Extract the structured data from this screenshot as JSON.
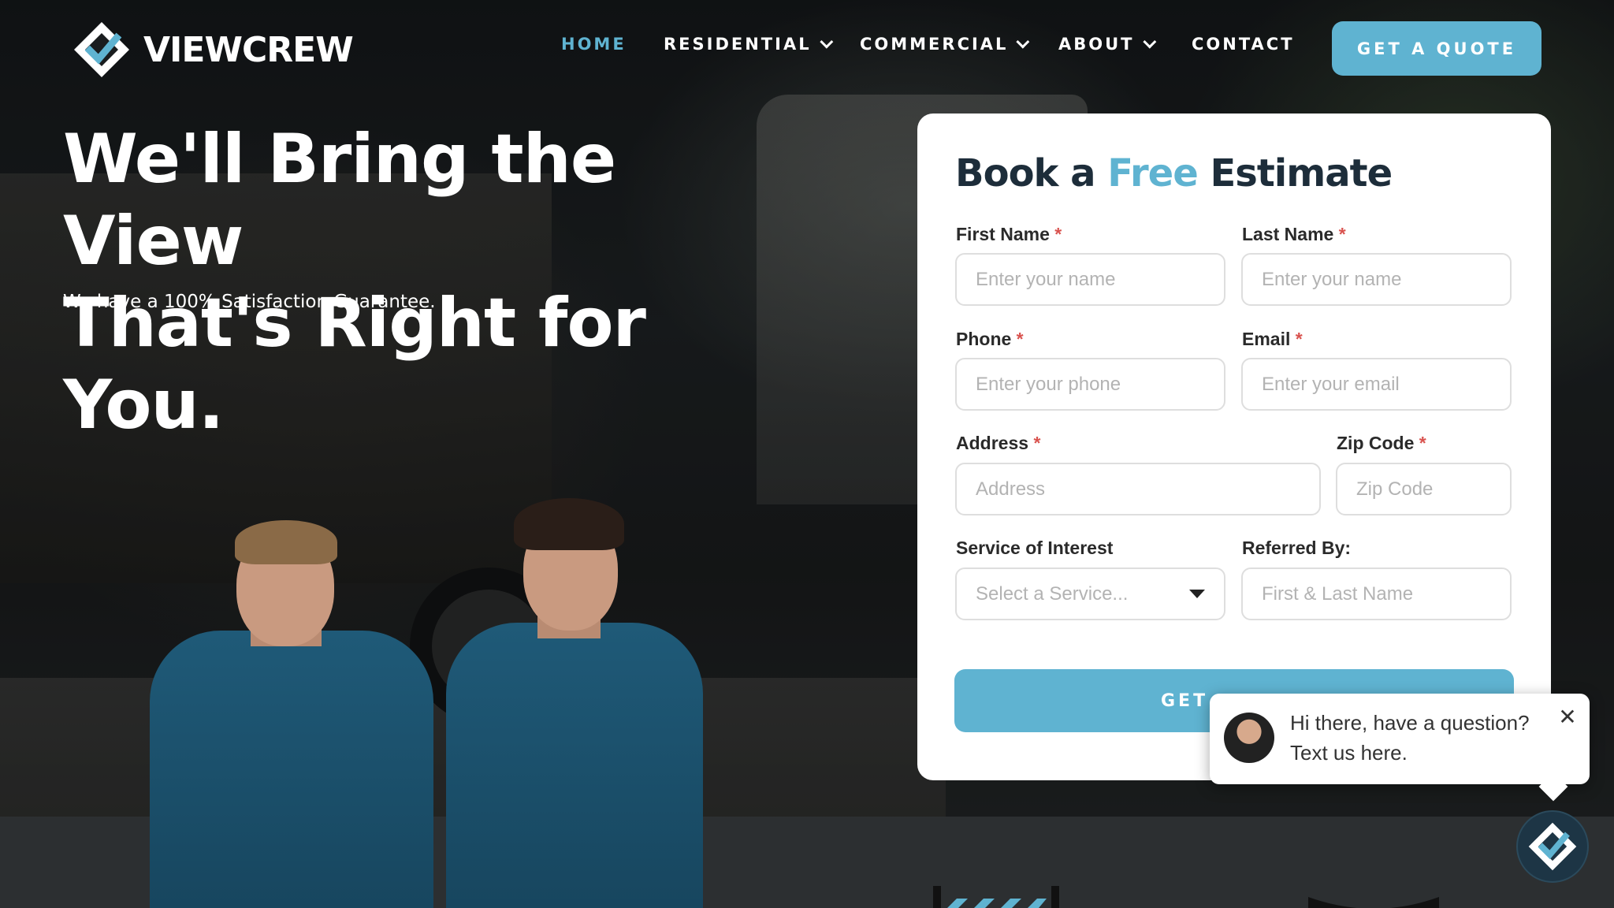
{
  "brand": {
    "name": "VIEWCREW",
    "accent_color": "#5fb3d1",
    "dark_color": "#1d2d3a"
  },
  "nav": {
    "items": [
      {
        "label": "HOME",
        "active": true,
        "dropdown": false
      },
      {
        "label": "RESIDENTIAL",
        "active": false,
        "dropdown": true
      },
      {
        "label": "COMMERCIAL",
        "active": false,
        "dropdown": true
      },
      {
        "label": "ABOUT",
        "active": false,
        "dropdown": true
      },
      {
        "label": "CONTACT",
        "active": false,
        "dropdown": false
      }
    ],
    "cta_label": "GET A QUOTE"
  },
  "hero": {
    "headline_line1": "We'll Bring the View",
    "headline_line2": "That's Right for You.",
    "subline": "We have a 100% Satisfaction Guarantee."
  },
  "form": {
    "title_pre": "Book a",
    "title_accent": "Free",
    "title_post": "Estimate",
    "required_mark": "*",
    "first_name": {
      "label": "First Name",
      "placeholder": "Enter your name"
    },
    "last_name": {
      "label": "Last Name",
      "placeholder": "Enter your name"
    },
    "phone": {
      "label": "Phone",
      "placeholder": "Enter your phone"
    },
    "email": {
      "label": "Email",
      "placeholder": "Enter your email"
    },
    "address": {
      "label": "Address",
      "placeholder": "Address"
    },
    "zip": {
      "label": "Zip Code",
      "placeholder": "Zip Code"
    },
    "service": {
      "label": "Service of Interest",
      "selected": "Select a Service..."
    },
    "referred": {
      "label": "Referred By:",
      "placeholder": "First & Last Name"
    },
    "submit_label": "GET"
  },
  "chat": {
    "message": "Hi there, have a question? Text us here.",
    "close_glyph": "✕",
    "icons": [
      "agent-avatar",
      "close-icon",
      "chat-launcher-logo-icon"
    ]
  }
}
